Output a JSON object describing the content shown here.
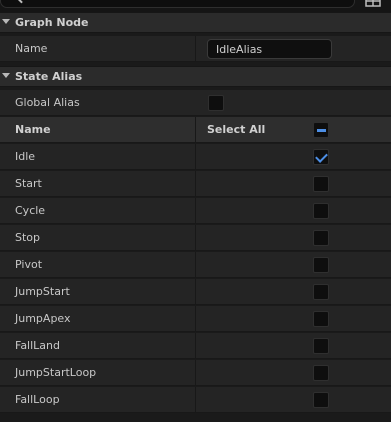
{
  "colors": {
    "accent": "#4d8fe6",
    "panel": "#242424",
    "category": "#2b2b2b",
    "background": "#1a1a1a"
  },
  "toolbar": {
    "search_icon": "search-icon",
    "settings_icon": "settings-icon"
  },
  "graph_node": {
    "title": "Graph Node",
    "name_label": "Name",
    "name_value": "IdleAlias"
  },
  "state_alias": {
    "title": "State Alias",
    "global_alias_label": "Global Alias",
    "global_alias_checked": false,
    "name_header": "Name",
    "select_all_label": "Select All",
    "select_all_state": "partial",
    "states": [
      {
        "name": "Idle",
        "checked": true
      },
      {
        "name": "Start",
        "checked": false
      },
      {
        "name": "Cycle",
        "checked": false
      },
      {
        "name": "Stop",
        "checked": false
      },
      {
        "name": "Pivot",
        "checked": false
      },
      {
        "name": "JumpStart",
        "checked": false
      },
      {
        "name": "JumpApex",
        "checked": false
      },
      {
        "name": "FallLand",
        "checked": false
      },
      {
        "name": "JumpStartLoop",
        "checked": false
      },
      {
        "name": "FallLoop",
        "checked": false
      }
    ]
  }
}
